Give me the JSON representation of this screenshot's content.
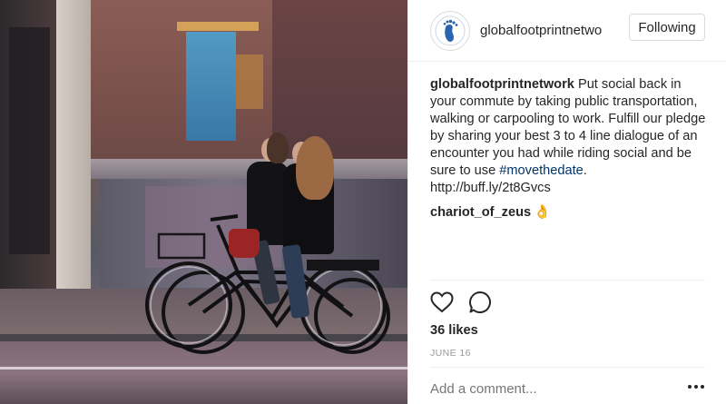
{
  "post": {
    "image_alt": "Two women riding bicycles on a city street",
    "account": {
      "username": "globalfootprintnetwo",
      "follow_label": "Following"
    },
    "caption": {
      "author": "globalfootprintnetwork",
      "text_before": " Put social back in your commute by taking public transportation, walking or carpooling to work. Fulfill our pledge by sharing your best 3 to 4 line dialogue of an encounter you had while riding social and be sure to use ",
      "hashtag": "#movethedate",
      "text_after": ". http://buff.ly/2t8Gvcs"
    },
    "comments": [
      {
        "author": "chariot_of_zeus",
        "text": "👌"
      }
    ],
    "actions": {
      "like_icon": "heart-icon",
      "comment_icon": "comment-icon"
    },
    "likes": "36 likes",
    "date": "JUNE 16",
    "add_comment_placeholder": "Add a comment...",
    "more_icon": "more-options-icon"
  },
  "colors": {
    "hashtag": "#003569",
    "text": "#262626",
    "muted": "#999999",
    "border": "#dbdbdb"
  }
}
